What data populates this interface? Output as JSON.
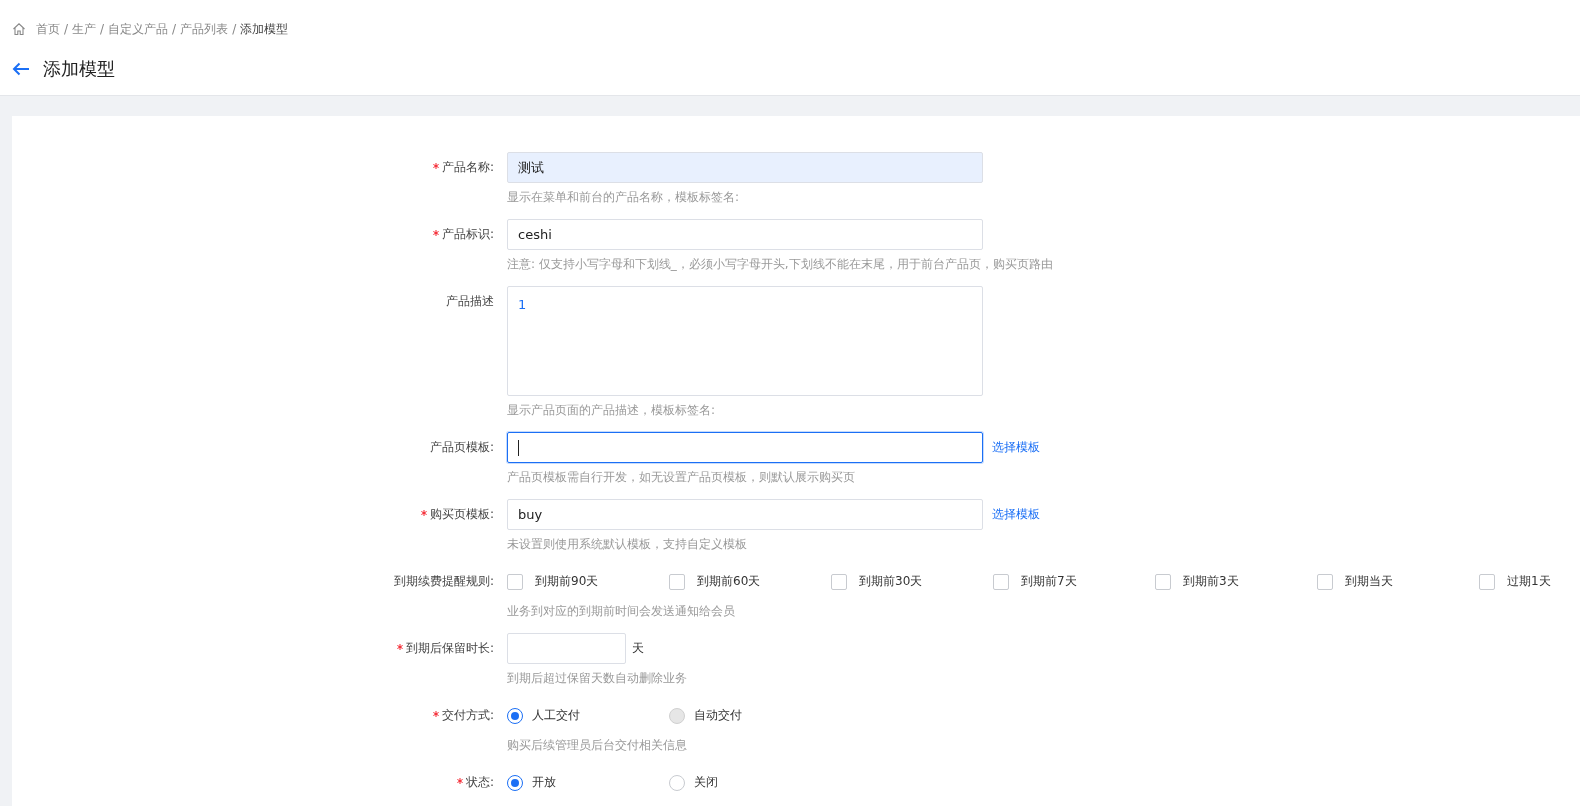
{
  "breadcrumb": {
    "separator": "/",
    "items": [
      {
        "label": "首页",
        "current": false
      },
      {
        "label": "生产",
        "current": false
      },
      {
        "label": "自定义产品",
        "current": false
      },
      {
        "label": "产品列表",
        "current": false
      },
      {
        "label": "添加模型",
        "current": true
      }
    ]
  },
  "page_title": "添加模型",
  "form": [
    {
      "kind": "input",
      "label": "产品名称:",
      "required": true,
      "value": "测试",
      "autofilled": true,
      "focused": false,
      "hint": "显示在菜单和前台的产品名称，模板标签名:"
    },
    {
      "kind": "input",
      "label": "产品标识:",
      "required": true,
      "value": "ceshi",
      "autofilled": false,
      "focused": false,
      "hint": "注意: 仅支持小写字母和下划线_，必须小写字母开头,下划线不能在末尾，用于前台产品页，购买页路由"
    },
    {
      "kind": "textarea",
      "label": "产品描述",
      "required": false,
      "value": "1",
      "hint": "显示产品页面的产品描述，模板标签名:"
    },
    {
      "kind": "input",
      "label": "产品页模板:",
      "required": false,
      "autofilled": false,
      "focused": true,
      "link": "选择模板",
      "hint": "产品页模板需自行开发，如无设置产品页模板，则默认展示购买页"
    },
    {
      "kind": "input",
      "label": "购买页模板:",
      "required": true,
      "value": "buy",
      "autofilled": false,
      "focused": false,
      "link": "选择模板",
      "hint": "未设置则使用系统默认模板，支持自定义模板"
    },
    {
      "kind": "checkboxes",
      "label": "到期续费提醒规则:",
      "required": false,
      "hint": "业务到对应的到期前时间会发送通知给会员",
      "options": [
        {
          "label": "到期前90天",
          "checked": false
        },
        {
          "label": "到期前60天",
          "checked": false
        },
        {
          "label": "到期前30天",
          "checked": false
        },
        {
          "label": "到期前7天",
          "checked": false
        },
        {
          "label": "到期前3天",
          "checked": false
        },
        {
          "label": "到期当天",
          "checked": false
        },
        {
          "label": "过期1天",
          "checked": false
        }
      ]
    },
    {
      "kind": "input_suffix",
      "label": "到期后保留时长:",
      "required": true,
      "suffix": "天",
      "hint": "到期后超过保留天数自动删除业务"
    },
    {
      "kind": "radios",
      "label": "交付方式:",
      "required": true,
      "hint": "购买后续管理员后台交付相关信息",
      "options": [
        {
          "label": "人工交付",
          "selected": true,
          "disabled": false
        },
        {
          "label": "自动交付",
          "selected": false,
          "disabled": true
        }
      ]
    },
    {
      "kind": "radios",
      "label": "状态:",
      "required": true,
      "options": [
        {
          "label": "开放",
          "selected": true,
          "disabled": false
        },
        {
          "label": "关闭",
          "selected": false,
          "disabled": false
        }
      ]
    }
  ]
}
